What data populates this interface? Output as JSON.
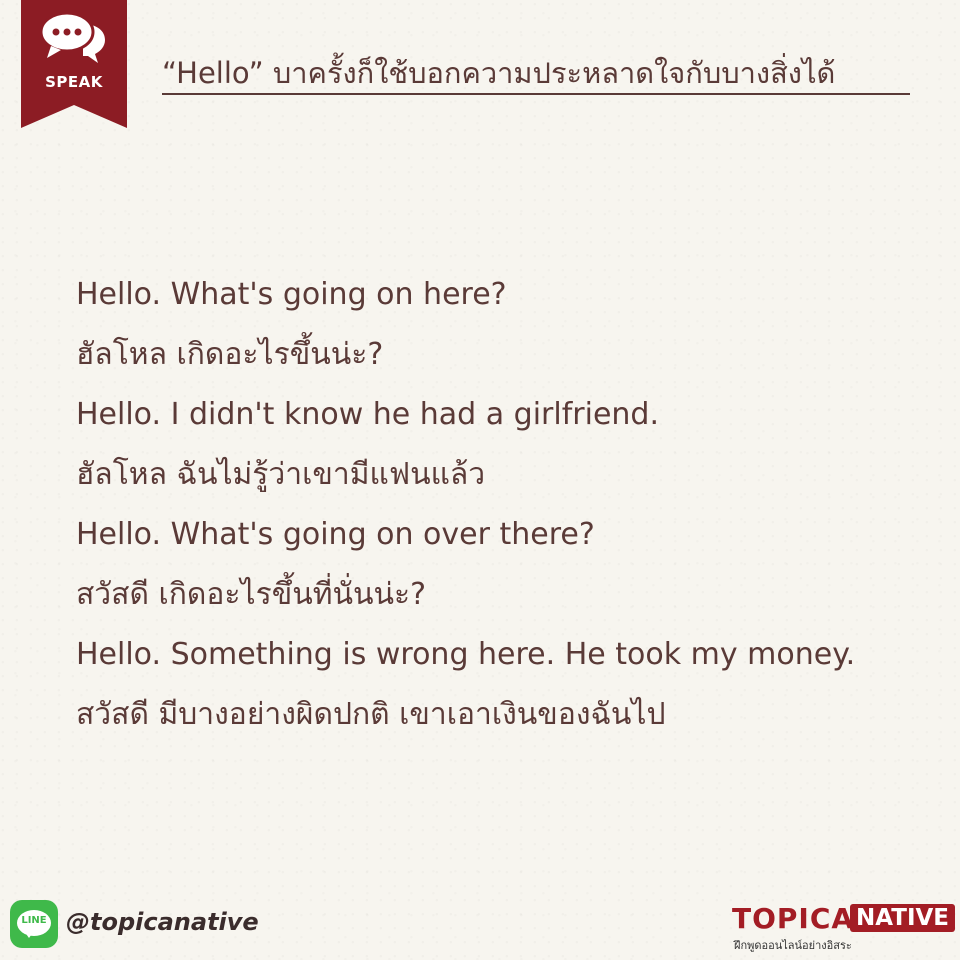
{
  "badge": {
    "label": "SPEAK",
    "icon": "speech-bubbles-icon"
  },
  "header": {
    "title": "“Hello” บาครั้งก็ใช้บอกความประหลาดใจกับบางสิ่งได้"
  },
  "lines": [
    "Hello. What's going on here?",
    "ฮัลโหล เกิดอะไรขึ้นน่ะ?",
    "Hello. I didn't know he had a girlfriend.",
    "ฮัลโหล ฉันไม่รู้ว่าเขามีแฟนแล้ว",
    "Hello. What's going on over there?",
    "สวัสดี เกิดอะไรขึ้นที่นั่นน่ะ?",
    "Hello. Something is wrong here. He took my money.",
    "สวัสดี มีบางอย่างผิดปกติ เขาเอาเงินของฉันไป"
  ],
  "footer": {
    "line_icon_label": "LINE",
    "handle": "@topicanative",
    "logo": {
      "brand": "TOPICA",
      "badge": "NATIVE",
      "tagline": "ฝึกพูดออนไลน์อย่างอิสระ"
    }
  },
  "colors": {
    "accent": "#8c1c24",
    "text": "#5a3a37",
    "line_green": "#3fb94a"
  }
}
